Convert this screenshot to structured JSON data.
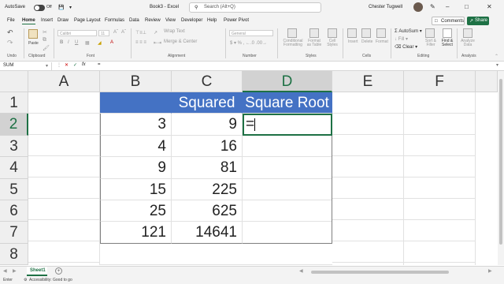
{
  "titlebar": {
    "autosave": "AutoSave",
    "toggle_state": "Off",
    "filename": "Book3 - Excel",
    "search_placeholder": "Search (Alt+Q)",
    "user": "Chester Tugwell"
  },
  "menu": {
    "items": [
      "File",
      "Home",
      "Insert",
      "Draw",
      "Page Layout",
      "Formulas",
      "Data",
      "Review",
      "View",
      "Developer",
      "Help",
      "Power Pivot"
    ],
    "active": "Home",
    "comments": "Comments",
    "share": "Share"
  },
  "ribbon": {
    "groups": [
      "Undo",
      "Clipboard",
      "Font",
      "Alignment",
      "Number",
      "Styles",
      "Cells",
      "Editing",
      "Analysis"
    ],
    "paste": "Paste",
    "font_name": "Calibri",
    "font_size": "11",
    "wrap_text": "Wrap Text",
    "merge_center": "Merge & Center",
    "number_format": "General",
    "conditional_formatting": "Conditional Formatting",
    "format_as_table": "Format as Table",
    "cell_styles": "Cell Styles",
    "insert": "Insert",
    "delete": "Delete",
    "format": "Format",
    "autosum": "AutoSum",
    "fill": "Fill",
    "clear": "Clear",
    "sort_filter": "Sort & Filter",
    "find_select": "Find & Select",
    "analyze_data": "Analyze Data"
  },
  "formula_bar": {
    "name_box": "SUM",
    "fx": "fx",
    "value": "="
  },
  "grid": {
    "columns": [
      "A",
      "B",
      "C",
      "D",
      "E",
      "F"
    ],
    "rows": [
      "1",
      "2",
      "3",
      "4",
      "5",
      "6",
      "7",
      "8"
    ],
    "header_row": [
      "",
      "Squared",
      "Square Root"
    ],
    "data": [
      [
        "3",
        "9",
        "="
      ],
      [
        "4",
        "16",
        ""
      ],
      [
        "9",
        "81",
        ""
      ],
      [
        "15",
        "225",
        ""
      ],
      [
        "25",
        "625",
        ""
      ],
      [
        "121",
        "14641",
        ""
      ]
    ]
  },
  "sheets": {
    "tabs": [
      "Sheet1"
    ],
    "add": "+"
  },
  "status": {
    "mode": "Enter",
    "accessibility": "Accessibility: Good to go"
  }
}
